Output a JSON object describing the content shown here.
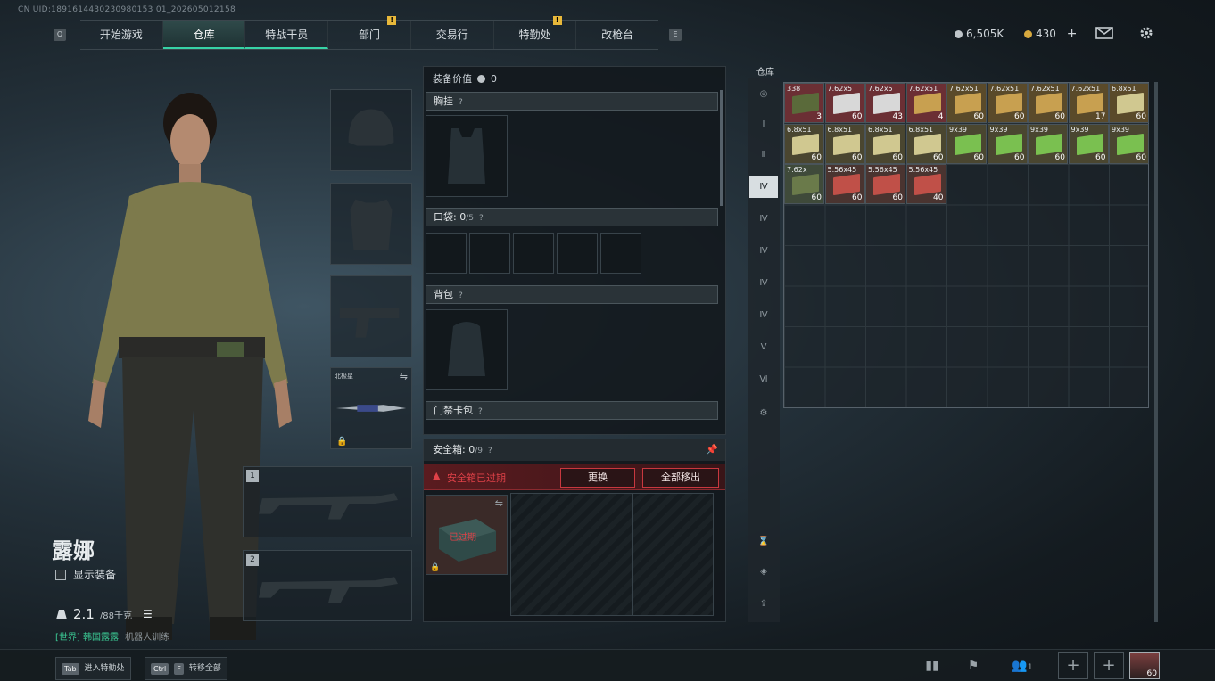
{
  "uid_text": "CN UID:1891614430230980153 01_202605012158",
  "nav": {
    "left_key": "Q",
    "right_key": "E",
    "tabs": [
      "开始游戏",
      "仓库",
      "特战干员",
      "部门",
      "交易行",
      "特勤处",
      "改枪台"
    ],
    "active_tab": "仓库",
    "alert_glyph": "!"
  },
  "currency": {
    "silver": "6,505K",
    "gold": "430",
    "gold_add": "+"
  },
  "colors": {
    "accent": "#37d3a6",
    "alert": "#e8b83a",
    "danger": "#c8383f"
  },
  "character": {
    "name": "露娜",
    "show_gear_label": "显示装备",
    "weight_value": "2.1",
    "weight_max": "/88千克",
    "status_text": "[世界] 韩国露露",
    "status_extra": "机器人训练"
  },
  "equip": {
    "melee_name": "北极星",
    "weapon_slot_1": "1",
    "weapon_slot_2": "2"
  },
  "loadout": {
    "value_label": "装备价值",
    "value": "0",
    "chest_rig_label": "胸挂",
    "pockets_label": "口袋:",
    "pockets_used": "0",
    "pockets_max": "/5",
    "backpack_label": "背包",
    "keycard_label": "门禁卡包",
    "help_glyph": "?"
  },
  "safebox": {
    "label": "安全箱:",
    "used": "0",
    "max": "/9",
    "expired_warning": "安全箱已过期",
    "replace_button": "更换",
    "move_all_button": "全部移出",
    "expired_tag": "已过期"
  },
  "stash": {
    "title": "仓库",
    "items": [
      {
        "name": "338",
        "count": "3",
        "color": "#6b2f34",
        "box": "#5a6a3a"
      },
      {
        "name": "7.62x5",
        "count": "60",
        "color": "#6b2f34",
        "box": "#d8d8d8"
      },
      {
        "name": "7.62x5",
        "count": "43",
        "color": "#6b2f34",
        "box": "#d8d8d8"
      },
      {
        "name": "7.62x51",
        "count": "4",
        "color": "#6b2f34",
        "box": "#c8a050"
      },
      {
        "name": "7.62x51",
        "count": "60",
        "color": "#5a4a2a",
        "box": "#c8a050"
      },
      {
        "name": "7.62x51",
        "count": "60",
        "color": "#5a4a2a",
        "box": "#c8a050"
      },
      {
        "name": "7.62x51",
        "count": "60",
        "color": "#5a4a2a",
        "box": "#c8a050"
      },
      {
        "name": "7.62x51",
        "count": "17",
        "color": "#5a4a2a",
        "box": "#c8a050"
      },
      {
        "name": "6.8x51",
        "count": "60",
        "color": "#5a4a2a",
        "box": "#d0c890"
      },
      {
        "name": "6.8x51",
        "count": "60",
        "color": "#4a4630",
        "box": "#d0c890"
      },
      {
        "name": "6.8x51",
        "count": "60",
        "color": "#4a4630",
        "box": "#d0c890"
      },
      {
        "name": "6.8x51",
        "count": "60",
        "color": "#4a4630",
        "box": "#d0c890"
      },
      {
        "name": "6.8x51",
        "count": "60",
        "color": "#4a4630",
        "box": "#d0c890"
      },
      {
        "name": "9x39",
        "count": "60",
        "color": "#4a4630",
        "box": "#7ac050"
      },
      {
        "name": "9x39",
        "count": "60",
        "color": "#4a4630",
        "box": "#7ac050"
      },
      {
        "name": "9x39",
        "count": "60",
        "color": "#4a4630",
        "box": "#7ac050"
      },
      {
        "name": "9x39",
        "count": "60",
        "color": "#4a4630",
        "box": "#7ac050"
      },
      {
        "name": "9x39",
        "count": "60",
        "color": "#4a4630",
        "box": "#7ac050"
      },
      {
        "name": "7.62x",
        "count": "60",
        "color": "#3f4a3a",
        "box": "#6a7a4a"
      },
      {
        "name": "5.56x45",
        "count": "60",
        "color": "#4a3430",
        "box": "#c05048"
      },
      {
        "name": "5.56x45",
        "count": "60",
        "color": "#4a3430",
        "box": "#c05048"
      },
      {
        "name": "5.56x45",
        "count": "40",
        "color": "#4a3430",
        "box": "#c05048"
      }
    ]
  },
  "bottom": {
    "operator_button": "进入特勤处",
    "operator_key": "Tab",
    "move_all_button": "转移全部",
    "move_all_key1": "Ctrl",
    "move_all_key2": "F",
    "squad_count": "1",
    "avatar_level": "60"
  }
}
